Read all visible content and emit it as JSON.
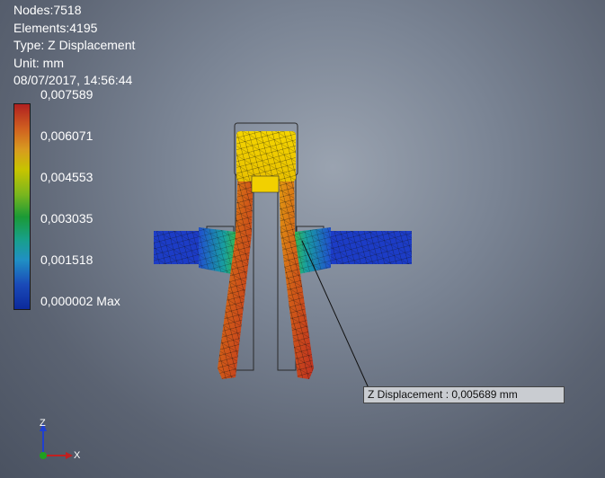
{
  "info": {
    "nodes": "Nodes:7518",
    "elements": "Elements:4195",
    "type": "Type: Z Displacement",
    "unit": "Unit: mm",
    "datetime": "08/07/2017, 14:56:44"
  },
  "legend": {
    "labels": [
      "0,007589",
      "0,006071",
      "0,004553",
      "0,003035",
      "0,001518",
      "0,000002 Max"
    ]
  },
  "probe": {
    "label": "Z Displacement : 0,005689 mm"
  },
  "triad": {
    "z": "Z",
    "x": "X"
  },
  "colors": {
    "max": "#b02020",
    "mid": "#1a9a36",
    "min": "#0c2a9c"
  }
}
